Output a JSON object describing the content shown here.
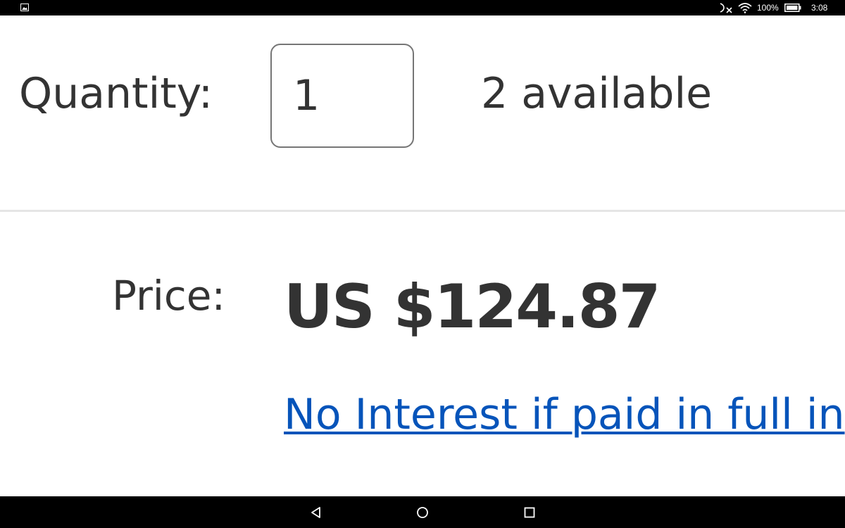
{
  "status_bar": {
    "battery": "100%",
    "time": "3:08",
    "icons": [
      "image-notification-icon",
      "bluetooth-off-icon",
      "wifi-icon",
      "battery-icon"
    ]
  },
  "listing": {
    "quantity_label": "Quantity:",
    "quantity_value": "1",
    "available_text": "2 available",
    "price_label": "Price:",
    "price_value": "US $124.87",
    "financing_link": "No Interest if paid in full in"
  },
  "nav_bar": {
    "icons": [
      "back-icon",
      "home-icon",
      "recents-icon"
    ]
  },
  "colors": {
    "text": "#333333",
    "link": "#0654ba",
    "input_border": "#767676",
    "divider": "#e5e5e5",
    "system_bars": "#000000"
  }
}
